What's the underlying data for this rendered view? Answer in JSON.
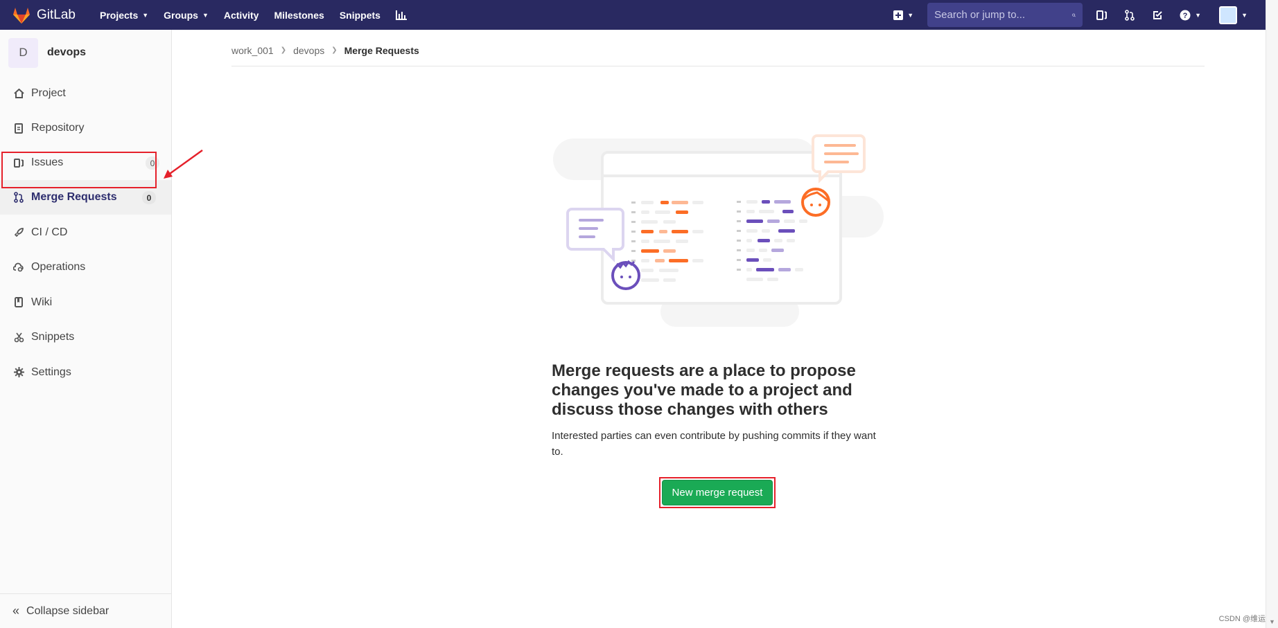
{
  "navbar": {
    "brand": "GitLab",
    "links": [
      "Projects",
      "Groups",
      "Activity",
      "Milestones",
      "Snippets"
    ],
    "search_placeholder": "Search or jump to..."
  },
  "sidebar": {
    "project_initial": "D",
    "project_name": "devops",
    "items": [
      {
        "label": "Project",
        "icon": "home-icon"
      },
      {
        "label": "Repository",
        "icon": "doc-icon"
      },
      {
        "label": "Issues",
        "icon": "issues-icon",
        "count": "0"
      },
      {
        "label": "Merge Requests",
        "icon": "merge-request-icon",
        "count": "0"
      },
      {
        "label": "CI / CD",
        "icon": "rocket-icon"
      },
      {
        "label": "Operations",
        "icon": "cloud-gear-icon"
      },
      {
        "label": "Wiki",
        "icon": "book-icon"
      },
      {
        "label": "Snippets",
        "icon": "scissors-icon"
      },
      {
        "label": "Settings",
        "icon": "gear-icon"
      }
    ],
    "collapse_label": "Collapse sidebar"
  },
  "breadcrumb": {
    "items": [
      "work_001",
      "devops",
      "Merge Requests"
    ]
  },
  "empty_state": {
    "title": "Merge requests are a place to propose changes you've made to a project and discuss those changes with others",
    "description": "Interested parties can even contribute by pushing commits if they want to.",
    "button_label": "New merge request"
  },
  "watermark": "CSDN @维运",
  "colors": {
    "navbar": "#292961",
    "button_green": "#1aaa55",
    "annotation_red": "#e5202a"
  }
}
